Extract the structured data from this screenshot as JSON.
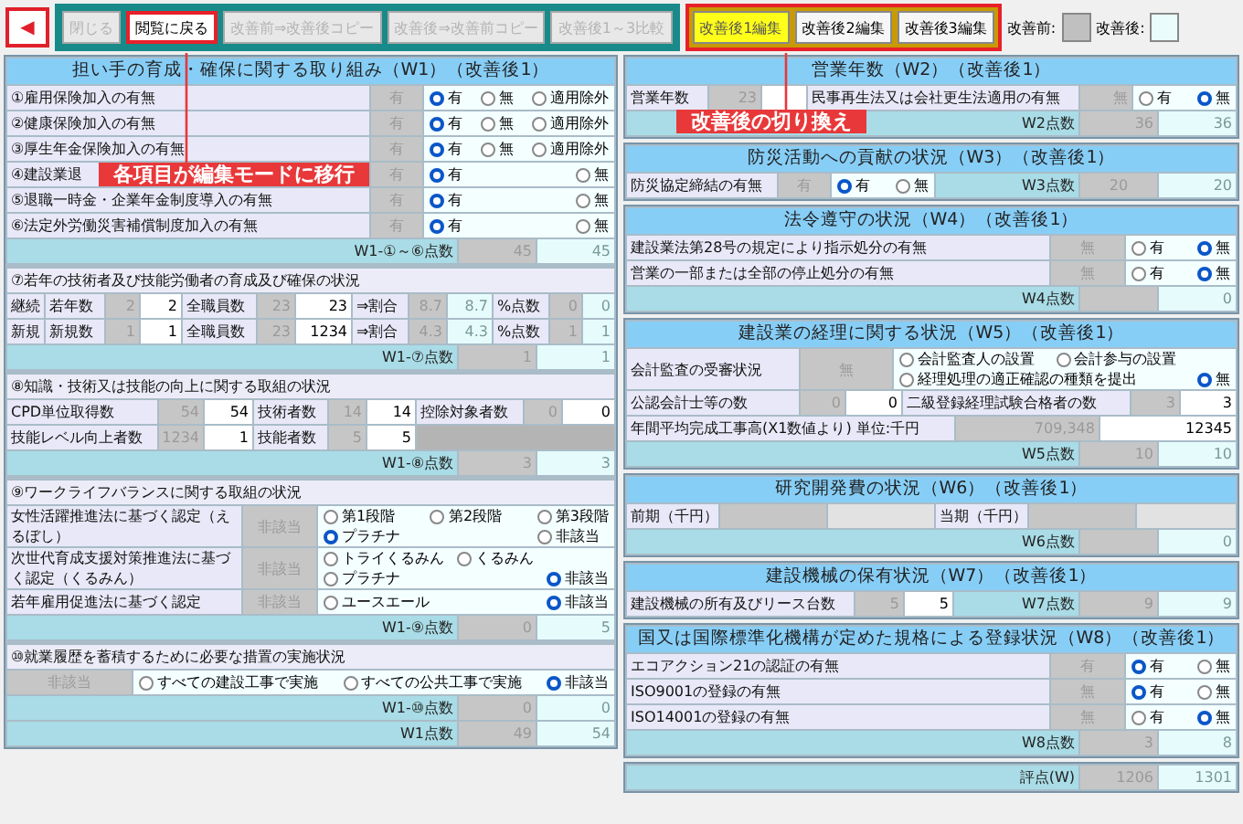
{
  "toolbar": {
    "back": "◀",
    "buttons": [
      {
        "label": "閉じる",
        "disabled": true,
        "highlighted": false
      },
      {
        "label": "閲覧に戻る",
        "disabled": false,
        "highlighted": true
      },
      {
        "label": "改善前⇒改善後コピー",
        "disabled": true,
        "highlighted": false
      },
      {
        "label": "改善後⇒改善前コピー",
        "disabled": true,
        "highlighted": false
      },
      {
        "label": "改善後1～3比較",
        "disabled": true,
        "highlighted": false
      }
    ],
    "edit_tabs_highlighted": true,
    "edit_tabs": [
      {
        "label": "改善後1編集",
        "selected": true
      },
      {
        "label": "改善後2編集",
        "selected": false
      },
      {
        "label": "改善後3編集",
        "selected": false
      }
    ],
    "legend": [
      {
        "label": "改善前:",
        "color": "#c0c0c0"
      },
      {
        "label": "改善後:",
        "color": "#eafcfc"
      }
    ]
  },
  "callouts": [
    {
      "text": "各項目が編集モードに移行"
    },
    {
      "text": "改善後の切り換え"
    }
  ],
  "left": {
    "title": "担い手の育成・確保に関する取り組み（W1）（改善後1）",
    "sections": [
      {
        "rows": [
          {
            "kind": "check3",
            "cells": [
              {
                "kind": "label",
                "text": "①雇用保険加入の有無"
              },
              {
                "kind": "before",
                "text": "有"
              },
              {
                "kind": "options",
                "options": [
                  {
                    "label": "有",
                    "selected": true
                  },
                  {
                    "label": "無",
                    "selected": false
                  },
                  {
                    "label": "適用除外",
                    "selected": false
                  }
                ]
              }
            ]
          },
          {
            "kind": "check3",
            "cells": [
              {
                "kind": "label",
                "text": "②健康保険加入の有無"
              },
              {
                "kind": "before",
                "text": "有"
              },
              {
                "kind": "options",
                "options": [
                  {
                    "label": "有",
                    "selected": true
                  },
                  {
                    "label": "無",
                    "selected": false
                  },
                  {
                    "label": "適用除外",
                    "selected": false
                  }
                ]
              }
            ]
          },
          {
            "kind": "check3",
            "cells": [
              {
                "kind": "label",
                "text": "③厚生年金保険加入の有無"
              },
              {
                "kind": "before",
                "text": "有"
              },
              {
                "kind": "options",
                "options": [
                  {
                    "label": "有",
                    "selected": true
                  },
                  {
                    "label": "無",
                    "selected": false
                  },
                  {
                    "label": "適用除外",
                    "selected": false
                  }
                ]
              }
            ]
          },
          {
            "kind": "check3",
            "cells": [
              {
                "kind": "label",
                "text": "④建設業退"
              },
              {
                "kind": "before",
                "text": "有"
              },
              {
                "kind": "options",
                "options": [
                  {
                    "label": "有",
                    "selected": true
                  },
                  {
                    "label": "無",
                    "selected": false
                  }
                ]
              }
            ]
          },
          {
            "kind": "check3",
            "cells": [
              {
                "kind": "label",
                "text": "⑤退職一時金・企業年金制度導入の有無"
              },
              {
                "kind": "before",
                "text": "有"
              },
              {
                "kind": "options",
                "options": [
                  {
                    "label": "有",
                    "selected": true
                  },
                  {
                    "label": "無",
                    "selected": false
                  }
                ]
              }
            ]
          },
          {
            "kind": "check3",
            "cells": [
              {
                "kind": "label",
                "text": "⑥法定外労働災害補償制度加入の有無"
              },
              {
                "kind": "before",
                "text": "有"
              },
              {
                "kind": "options",
                "options": [
                  {
                    "label": "有",
                    "selected": true
                  },
                  {
                    "label": "無",
                    "selected": false
                  }
                ]
              }
            ]
          }
        ],
        "score": {
          "label": "W1-①～⑥点数",
          "before": "45",
          "after": "45"
        }
      },
      {
        "heading": "⑦若年の技術者及び技能労働者の育成及び確保の状況",
        "rows": [
          {
            "kind": "ratio",
            "cells": [
              {
                "kind": "label",
                "text": "継続"
              },
              {
                "kind": "label",
                "text": "若年数"
              },
              {
                "kind": "before",
                "text": "2"
              },
              {
                "kind": "input",
                "text": "2"
              },
              {
                "kind": "label",
                "text": "全職員数"
              },
              {
                "kind": "before",
                "text": "23"
              },
              {
                "kind": "input",
                "text": "23"
              },
              {
                "kind": "label",
                "text": "⇒割合"
              },
              {
                "kind": "before",
                "text": "8.7"
              },
              {
                "kind": "after",
                "text": "8.7"
              },
              {
                "kind": "label",
                "text": "%点数"
              },
              {
                "kind": "before",
                "text": "0"
              },
              {
                "kind": "after",
                "text": "0"
              }
            ]
          },
          {
            "kind": "ratio",
            "cells": [
              {
                "kind": "label",
                "text": "新規"
              },
              {
                "kind": "label",
                "text": "新規数"
              },
              {
                "kind": "before",
                "text": "1"
              },
              {
                "kind": "input",
                "text": "1"
              },
              {
                "kind": "label",
                "text": "全職員数"
              },
              {
                "kind": "before",
                "text": "23"
              },
              {
                "kind": "input",
                "text": "1234"
              },
              {
                "kind": "label",
                "text": "⇒割合"
              },
              {
                "kind": "before",
                "text": "4.3"
              },
              {
                "kind": "after",
                "text": "4.3"
              },
              {
                "kind": "label",
                "text": "%点数"
              },
              {
                "kind": "before",
                "text": "1"
              },
              {
                "kind": "after",
                "text": "1"
              }
            ]
          }
        ],
        "score": {
          "label": "W1-⑦点数",
          "before": "1",
          "after": "1"
        }
      },
      {
        "heading": "⑧知識・技術又は技能の向上に関する取組の状況",
        "rows": [
          {
            "kind": "skill",
            "cells": [
              {
                "kind": "label",
                "text": "CPD単位取得数"
              },
              {
                "kind": "before",
                "text": "54"
              },
              {
                "kind": "input",
                "text": "54"
              },
              {
                "kind": "label",
                "text": "技術者数"
              },
              {
                "kind": "before",
                "text": "14"
              },
              {
                "kind": "input",
                "text": "14"
              },
              {
                "kind": "label",
                "text": "控除対象者数"
              },
              {
                "kind": "before",
                "text": "0"
              },
              {
                "kind": "input",
                "text": "0"
              }
            ]
          },
          {
            "kind": "skill",
            "cells": [
              {
                "kind": "label",
                "text": "技能レベル向上者数"
              },
              {
                "kind": "before",
                "text": "1234"
              },
              {
                "kind": "input",
                "text": "1"
              },
              {
                "kind": "label",
                "text": "技能者数"
              },
              {
                "kind": "before",
                "text": "5"
              },
              {
                "kind": "input",
                "text": "5"
              },
              {
                "kind": "filler"
              }
            ]
          }
        ],
        "score": {
          "label": "W1-⑧点数",
          "before": "3",
          "after": "3"
        }
      },
      {
        "heading": "⑨ワークライフバランスに関する取組の状況",
        "rows": [
          {
            "kind": "cert",
            "cells": [
              {
                "kind": "label",
                "text": "女性活躍推進法に基づく認定（えるぼし）"
              },
              {
                "kind": "before",
                "text": "非該当"
              },
              {
                "kind": "options",
                "options": [
                  {
                    "label": "第1段階",
                    "selected": false
                  },
                  {
                    "label": "第2段階",
                    "selected": false
                  },
                  {
                    "label": "第3段階",
                    "selected": false
                  },
                  {
                    "label": "プラチナ",
                    "selected": true
                  },
                  {
                    "label": "非該当",
                    "selected": false
                  }
                ]
              }
            ]
          },
          {
            "kind": "cert",
            "cells": [
              {
                "kind": "label",
                "text": "次世代育成支援対策推進法に基づく認定（くるみん）"
              },
              {
                "kind": "before",
                "text": "非該当"
              },
              {
                "kind": "options",
                "options": [
                  {
                    "label": "トライくるみん",
                    "selected": false
                  },
                  {
                    "label": "くるみん",
                    "selected": false
                  },
                  {
                    "label": "プラチナ",
                    "selected": false
                  },
                  {
                    "label": "非該当",
                    "selected": true
                  }
                ]
              }
            ]
          },
          {
            "kind": "cert",
            "cells": [
              {
                "kind": "label",
                "text": "若年雇用促進法に基づく認定"
              },
              {
                "kind": "before",
                "text": "非該当"
              },
              {
                "kind": "options",
                "options": [
                  {
                    "label": "ユースエール",
                    "selected": false
                  },
                  {
                    "label": "非該当",
                    "selected": true
                  }
                ]
              }
            ]
          }
        ],
        "score": {
          "label": "W1-⑨点数",
          "before": "0",
          "after": "5"
        }
      },
      {
        "heading": "⑩就業履歴を蓄積するために必要な措置の実施状況",
        "rows": [
          {
            "kind": "measure",
            "cells": [
              {
                "kind": "before",
                "text": "非該当"
              },
              {
                "kind": "options",
                "options": [
                  {
                    "label": "すべての建設工事で実施",
                    "selected": false
                  },
                  {
                    "label": "すべての公共工事で実施",
                    "selected": false
                  },
                  {
                    "label": "非該当",
                    "selected": true
                  }
                ]
              }
            ]
          }
        ],
        "score": {
          "label": "W1-⑩点数",
          "before": "0",
          "after": "0"
        }
      }
    ],
    "total": {
      "label": "W1点数",
      "before": "49",
      "after": "54"
    }
  },
  "right": {
    "panels": [
      {
        "title": "営業年数（W2）（改善後1）",
        "rows": [
          {
            "kind": "w2",
            "cells": [
              {
                "kind": "label",
                "text": "営業年数"
              },
              {
                "kind": "before",
                "text": "23"
              },
              {
                "kind": "input"
              },
              {
                "kind": "label",
                "text": "民事再生法又は会社更生法適用の有無"
              },
              {
                "kind": "before",
                "text": "無"
              },
              {
                "kind": "options",
                "options": [
                  {
                    "label": "有",
                    "selected": false
                  },
                  {
                    "label": "無",
                    "selected": true
                  }
                ]
              }
            ]
          }
        ],
        "score": {
          "label": "W2点数",
          "before": "36",
          "after": "36"
        }
      },
      {
        "title": "防災活動への貢献の状況（W3）（改善後1）",
        "rows": [
          {
            "kind": "w3",
            "cells": [
              {
                "kind": "label",
                "text": "防災協定締結の有無"
              },
              {
                "kind": "before",
                "text": "有"
              },
              {
                "kind": "options",
                "options": [
                  {
                    "label": "有",
                    "selected": true
                  },
                  {
                    "label": "無",
                    "selected": false
                  }
                ]
              },
              {
                "kind": "bar",
                "text": "W3点数"
              },
              {
                "kind": "before",
                "text": "20"
              },
              {
                "kind": "after",
                "text": "20"
              }
            ]
          }
        ]
      },
      {
        "title": "法令遵守の状況（W4）（改善後1）",
        "rows": [
          {
            "kind": "check2",
            "cells": [
              {
                "kind": "label",
                "text": "建設業法第28号の規定により指示処分の有無"
              },
              {
                "kind": "before",
                "text": "無"
              },
              {
                "kind": "options",
                "options": [
                  {
                    "label": "有",
                    "selected": false
                  },
                  {
                    "label": "無",
                    "selected": true
                  }
                ]
              }
            ]
          },
          {
            "kind": "check2",
            "cells": [
              {
                "kind": "label",
                "text": "営業の一部または全部の停止処分の有無"
              },
              {
                "kind": "before",
                "text": "無"
              },
              {
                "kind": "options",
                "options": [
                  {
                    "label": "有",
                    "selected": false
                  },
                  {
                    "label": "無",
                    "selected": true
                  }
                ]
              }
            ]
          }
        ],
        "score": {
          "label": "W4点数",
          "after": "0"
        }
      },
      {
        "title": "建設業の経理に関する状況（W5）（改善後1）",
        "audit": {
          "label": "会計監査の受審状況",
          "before": "無",
          "options": [
            {
              "label": "会計監査人の設置",
              "selected": false
            },
            {
              "label": "会計参与の設置",
              "selected": false
            },
            {
              "label": "経理処理の適正確認の種類を提出",
              "selected": false
            },
            {
              "label": "無",
              "selected": true
            }
          ]
        },
        "rows": [
          {
            "kind": "w5b",
            "cells": [
              {
                "kind": "label",
                "text": "公認会計士等の数"
              },
              {
                "kind": "before",
                "text": "0"
              },
              {
                "kind": "input",
                "text": "0"
              },
              {
                "kind": "label",
                "text": "二級登録経理試験合格者の数"
              },
              {
                "kind": "before",
                "text": "3"
              },
              {
                "kind": "input",
                "text": "3"
              }
            ]
          }
        ],
        "sales": {
          "label": "年間平均完成工事高(X1数値より) 単位:千円",
          "before": "709,348",
          "value": "12345"
        },
        "score": {
          "label": "W5点数",
          "before": "10",
          "after": "10"
        }
      },
      {
        "title": "研究開発費の状況（W6）（改善後1）",
        "rows": [
          {
            "kind": "w6",
            "cells": [
              {
                "kind": "label",
                "text": "前期（千円）"
              },
              {
                "kind": "before"
              },
              {
                "kind": "disabled"
              },
              {
                "kind": "label",
                "text": "当期（千円）"
              },
              {
                "kind": "before"
              },
              {
                "kind": "disabled"
              }
            ]
          }
        ],
        "score": {
          "label": "W6点数",
          "after": "0"
        }
      },
      {
        "title": "建設機械の保有状況（W7）（改善後1）",
        "rows": [
          {
            "kind": "w7",
            "cells": [
              {
                "kind": "label",
                "text": "建設機械の所有及びリース台数"
              },
              {
                "kind": "before",
                "text": "5"
              },
              {
                "kind": "input",
                "text": "5"
              },
              {
                "kind": "bar",
                "text": "W7点数"
              },
              {
                "kind": "before",
                "text": "9"
              },
              {
                "kind": "after",
                "text": "9"
              }
            ]
          }
        ]
      },
      {
        "title": "国又は国際標準化機構が定めた規格による登録状況（W8）（改善後1）",
        "rows": [
          {
            "kind": "check2",
            "cells": [
              {
                "kind": "label",
                "text": "エコアクション21の認証の有無"
              },
              {
                "kind": "before",
                "text": "有"
              },
              {
                "kind": "options",
                "options": [
                  {
                    "label": "有",
                    "selected": true
                  },
                  {
                    "label": "無",
                    "selected": false
                  }
                ]
              }
            ]
          },
          {
            "kind": "check2",
            "cells": [
              {
                "kind": "label",
                "text": "ISO9001の登録の有無"
              },
              {
                "kind": "before",
                "text": "無"
              },
              {
                "kind": "options",
                "options": [
                  {
                    "label": "有",
                    "selected": true
                  },
                  {
                    "label": "無",
                    "selected": false
                  }
                ]
              }
            ]
          },
          {
            "kind": "check2",
            "cells": [
              {
                "kind": "label",
                "text": "ISO14001の登録の有無"
              },
              {
                "kind": "before",
                "text": "無"
              },
              {
                "kind": "options",
                "options": [
                  {
                    "label": "有",
                    "selected": false
                  },
                  {
                    "label": "無",
                    "selected": true
                  }
                ]
              }
            ]
          }
        ],
        "score": {
          "label": "W8点数",
          "before": "3",
          "after": "8"
        }
      },
      {
        "score": {
          "label": "評点(W)",
          "before": "1206",
          "after": "1301"
        }
      }
    ]
  }
}
